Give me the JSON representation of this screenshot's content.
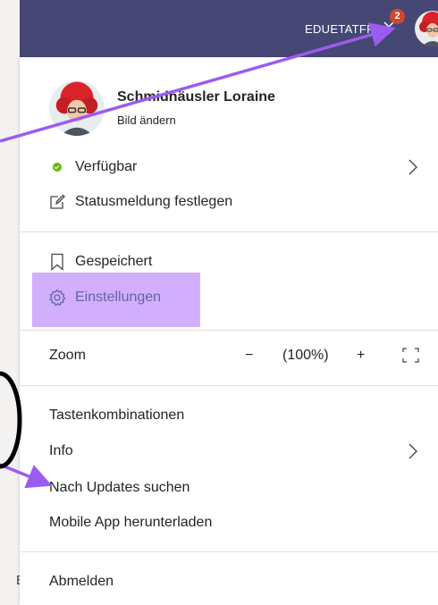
{
  "topbar": {
    "tenant": "EDUETATFR",
    "notification_count": "2",
    "background": "#464775"
  },
  "profile": {
    "name": "Schmidhäusler Loraine",
    "change_picture": "Bild ändern"
  },
  "menu": {
    "status": "Verfügbar",
    "status_message": "Statusmeldung festlegen",
    "saved": "Gespeichert",
    "settings": "Einstellungen",
    "zoom_label": "Zoom",
    "zoom_minus": "−",
    "zoom_value": "(100%)",
    "zoom_plus": "+",
    "shortcuts": "Tastenkombinationen",
    "info": "Info",
    "check_updates": "Nach Updates suchen",
    "mobile_app": "Mobile App herunterladen",
    "sign_out": "Abmelden"
  },
  "background_fragment": "B",
  "colors": {
    "accent": "#6264a7",
    "available": "#6bb700",
    "highlight": "#c9a1fb",
    "arrow": "#9b5cf0",
    "badge": "#cc4a31"
  }
}
